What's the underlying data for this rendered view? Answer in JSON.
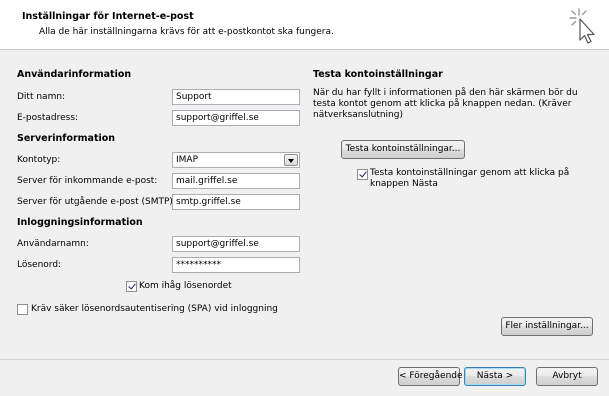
{
  "header": {
    "title": "Inställningar för Internet-e-post",
    "subtitle": "Alla de här inställningarna krävs för att e-postkontot ska fungera."
  },
  "user_info": {
    "heading": "Användarinformation",
    "name_label": "Ditt namn:",
    "name_value": "Support",
    "email_label": "E-postadress:",
    "email_value": "support@griffel.se"
  },
  "server_info": {
    "heading": "Serverinformation",
    "account_type_label": "Kontotyp:",
    "account_type_value": "IMAP",
    "incoming_label": "Server för inkommande e-post:",
    "incoming_value": "mail.griffel.se",
    "outgoing_label": "Server för utgående e-post (SMTP):",
    "outgoing_value": "smtp.griffel.se"
  },
  "login_info": {
    "heading": "Inloggningsinformation",
    "username_label": "Användarnamn:",
    "username_value": "support@griffel.se",
    "password_label": "Lösenord:",
    "password_value": "**********",
    "remember_label": "Kom ihåg lösenordet",
    "remember_checked": true,
    "spa_label": "Kräv säker lösenordsautentisering (SPA) vid inloggning",
    "spa_checked": false
  },
  "test": {
    "heading": "Testa kontoinställningar",
    "description": "När du har fyllt i informationen på den här skärmen bör du testa kontot genom att klicka på knappen nedan. (Kräver nätverksanslutning)",
    "test_button": "Testa kontoinställningar...",
    "auto_test_label": "Testa kontoinställningar genom att klicka på knappen Nästa",
    "auto_test_checked": true
  },
  "buttons": {
    "more_settings": "Fler inställningar...",
    "back": "< Föregående",
    "next": "Nästa >",
    "cancel": "Avbryt"
  },
  "icons": {
    "wizard": "cursor-sparkle-icon"
  }
}
